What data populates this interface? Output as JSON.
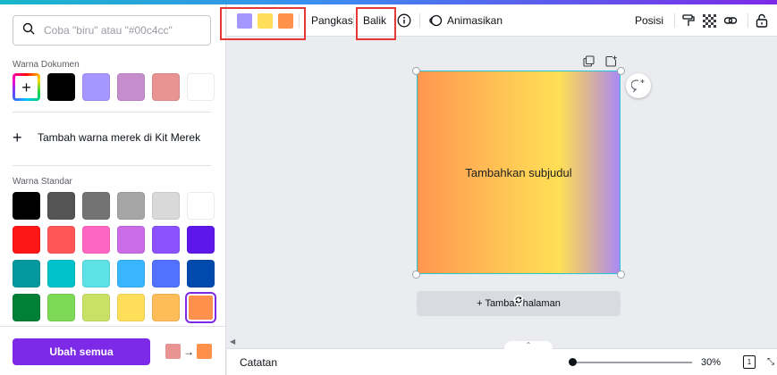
{
  "search": {
    "placeholder": "Coba \"biru\" atau \"#00c4cc\""
  },
  "document_colors": {
    "title": "Warna Dokumen",
    "add_label": "+",
    "swatches": [
      "#000000",
      "#a597ff",
      "#c68dcc",
      "#e99393",
      "#ffffff"
    ]
  },
  "add_brand": {
    "plus": "+",
    "label": "Tambah warna merek di Kit Merek"
  },
  "standard_colors": {
    "title": "Warna Standar",
    "rows": [
      [
        "#000000",
        "#545454",
        "#737373",
        "#a6a6a6",
        "#d9d9d9",
        "#ffffff"
      ],
      [
        "#ff1616",
        "#ff5757",
        "#ff66c4",
        "#cb6ce6",
        "#8c52ff",
        "#5e17eb"
      ],
      [
        "#03989e",
        "#00c2cb",
        "#5ce1e6",
        "#38b6ff",
        "#5271ff",
        "#004aad"
      ],
      [
        "#008037",
        "#7ed957",
        "#c9e265",
        "#ffde59",
        "#ffbd59",
        "#ff914d"
      ]
    ],
    "selected": "#ff914d"
  },
  "change_all": {
    "label": "Ubah semua",
    "from": "#e99393",
    "arrow": "→",
    "to": "#ff914d"
  },
  "toolbar": {
    "colors": [
      "#a597ff",
      "#ffde59",
      "#ff914d"
    ],
    "crop": "Pangkas",
    "flip": "Balik",
    "animate": "Animasikan",
    "position": "Posisi"
  },
  "canvas": {
    "text": "Tambahkan subjudul",
    "add_page": "+ Tambah halaman"
  },
  "bottom": {
    "notes": "Catatan",
    "zoom": "30%",
    "page_count": "1",
    "zoom_level": 0.3
  },
  "accent": "#7d2ae8"
}
